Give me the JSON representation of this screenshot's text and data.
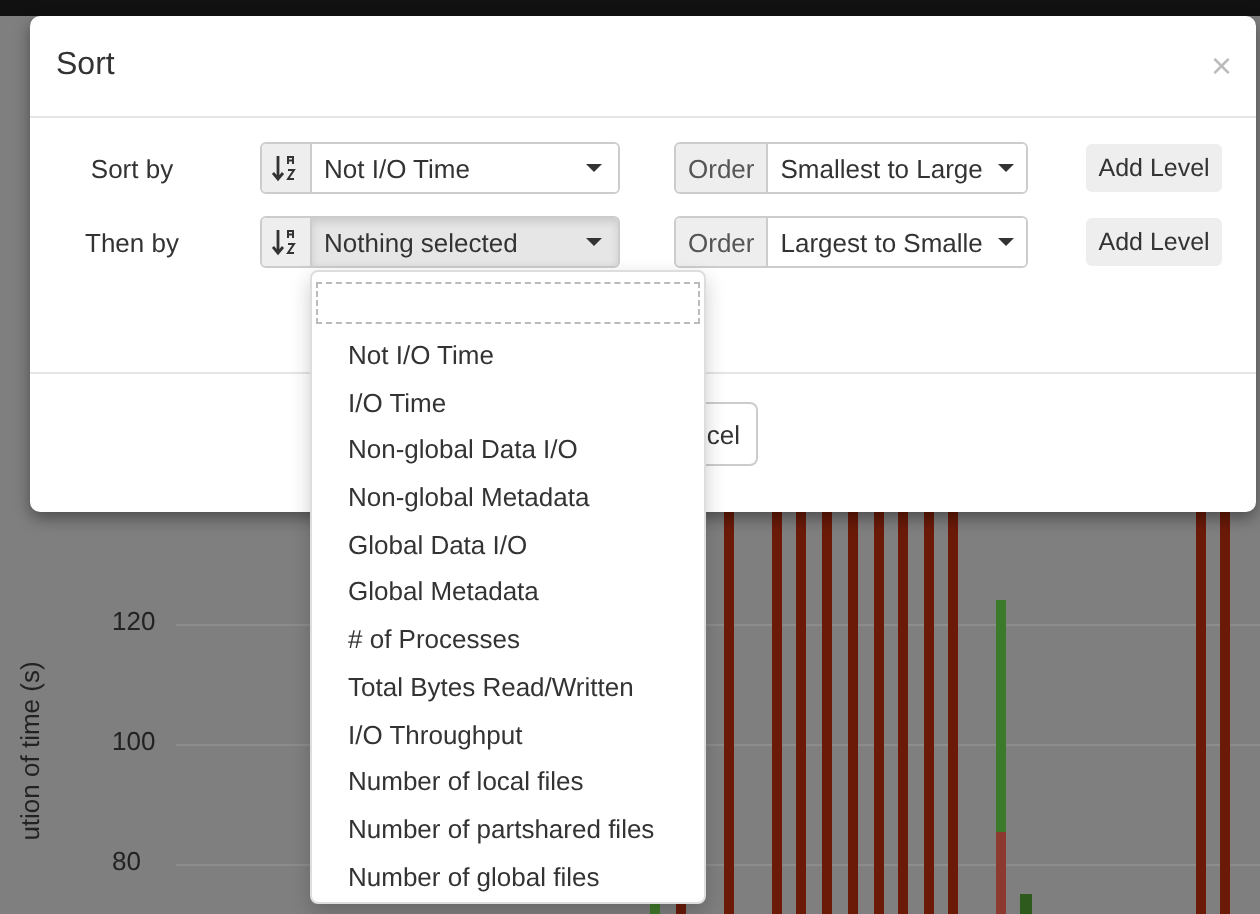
{
  "dialog": {
    "title": "Sort",
    "close": "×"
  },
  "levels": [
    {
      "label": "Sort by",
      "field": "Not I/O Time",
      "open": false,
      "order_label": "Order",
      "order": "Smallest to Large",
      "add_button": "Add Level"
    },
    {
      "label": "Then by",
      "field": "Nothing selected",
      "open": true,
      "order_label": "Order",
      "order": "Largest to Smalle",
      "add_button": "Add Level"
    }
  ],
  "footer_buttons": [
    "cel"
  ],
  "dropdown": {
    "options": [
      "Not I/O Time",
      "I/O Time",
      "Non-global Data I/O",
      "Non-global Metadata",
      "Global Data I/O",
      "Global Metadata",
      "# of Processes",
      "Total Bytes Read/Written",
      "I/O Throughput",
      "Number of local files",
      "Number of partshared files",
      "Number of global files"
    ]
  },
  "chart": {
    "y_ticks": [
      "120",
      "100",
      "80"
    ],
    "y_axis_label": "ution of time (s)"
  }
}
